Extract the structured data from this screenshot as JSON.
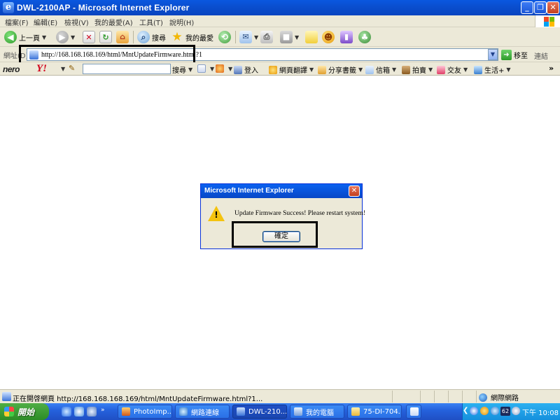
{
  "window": {
    "title": "DWL-2100AP - Microsoft Internet Explorer",
    "icon": "ie-icon",
    "controls": {
      "minimize": "_",
      "maximize": "❐",
      "close": "✕"
    }
  },
  "menubar": {
    "items": [
      "檔案(F)",
      "編輯(E)",
      "檢視(V)",
      "我的最愛(A)",
      "工具(T)",
      "說明(H)"
    ]
  },
  "toolbar": {
    "back_label": "上一頁",
    "search_label": "搜尋",
    "favorites_label": "我的最愛"
  },
  "addressbar": {
    "label": "網址(D)",
    "url": "http://168.168.168.169/html/MntUpdateFirmware.html?1",
    "go_label": "移至",
    "links_label": "連結"
  },
  "yahoo_toolbar": {
    "nero_logo": "nero",
    "yahoo_logo": "Y!",
    "search_button": "搜尋",
    "login_label": "登入",
    "items": [
      "網頁翻譯",
      "分享書籤",
      "信箱",
      "拍賣",
      "交友",
      "生活+"
    ],
    "more": "»"
  },
  "dialog": {
    "title": "Microsoft Internet Explorer",
    "message": "Update Firmware Success! Please restart system!",
    "ok_label": "確定",
    "icon": "warning-icon"
  },
  "statusbar": {
    "text": "正在開啓網頁 http://168.168.168.169/html/MntUpdateFirmware.html?1...",
    "zone": "網際網路"
  },
  "taskbar": {
    "start_label": "開始",
    "tasks": [
      "PhotoImp...",
      "網路連線",
      "DWL-210...",
      "我的電腦",
      "75-DI-704..."
    ],
    "tray_badge": "62",
    "clock": "下午 10:08"
  },
  "colors": {
    "title_bar": "#0a58e0",
    "chrome": "#ece9d8",
    "start_button": "#3c9a33",
    "taskbar": "#2562dd",
    "tray": "#1a9be6",
    "highlight_border": "#000000"
  }
}
